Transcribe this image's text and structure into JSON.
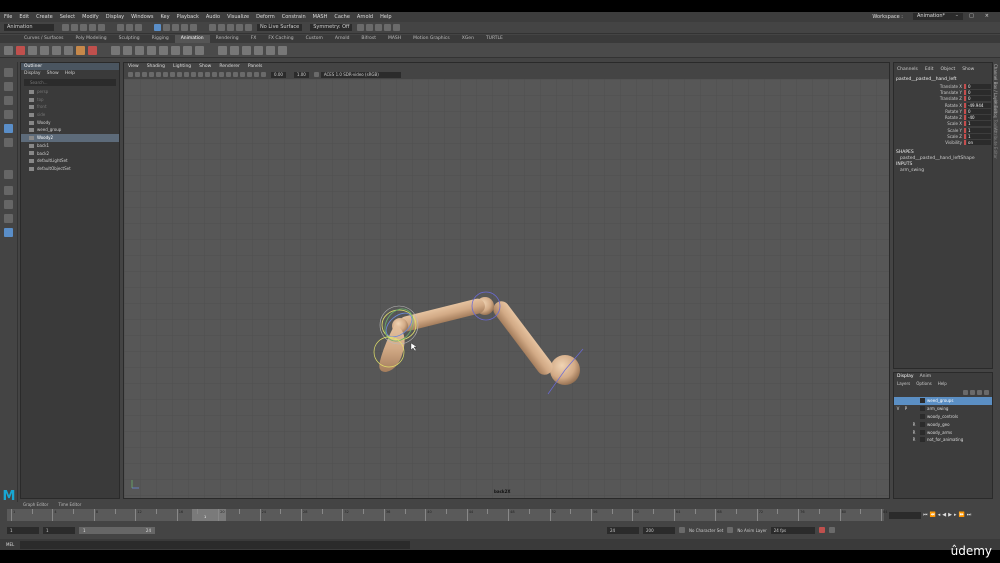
{
  "menus": [
    "File",
    "Edit",
    "Create",
    "Select",
    "Modify",
    "Display",
    "Windows",
    "Key",
    "Playback",
    "Audio",
    "Visualize",
    "Deform",
    "Constrain",
    "MASH",
    "Cache",
    "Arnold",
    "Help"
  ],
  "workspace": {
    "label": "Workspace :",
    "value": "Animation*"
  },
  "status": {
    "menuset": "Animation",
    "live_surface": "No Live Surface",
    "symmetry": "Symmetry: Off"
  },
  "shelf_tabs": [
    "Curves / Surfaces",
    "Poly Modeling",
    "Sculpting",
    "Rigging",
    "Animation",
    "Rendering",
    "FX",
    "FX Caching",
    "Custom",
    "Arnold",
    "Bifrost",
    "MASH",
    "Motion Graphics",
    "XGen",
    "TURTLE"
  ],
  "shelf_active": "Animation",
  "outliner": {
    "title": "Outliner",
    "menu": [
      "Display",
      "Show",
      "Help"
    ],
    "search_placeholder": "Search...",
    "items": [
      {
        "label": "persp",
        "state": "dim"
      },
      {
        "label": "top",
        "state": "dim"
      },
      {
        "label": "front",
        "state": "dim"
      },
      {
        "label": "side",
        "state": "dim"
      },
      {
        "label": "Woody",
        "state": "normal"
      },
      {
        "label": "weed_group",
        "state": "normal"
      },
      {
        "label": "Woody2",
        "state": "selected"
      },
      {
        "label": "back1",
        "state": "normal"
      },
      {
        "label": "back2",
        "state": "normal"
      },
      {
        "label": "defaultLightSet",
        "state": "normal"
      },
      {
        "label": "defaultObjectSet",
        "state": "normal"
      }
    ]
  },
  "viewport": {
    "menu": [
      "View",
      "Shading",
      "Lighting",
      "Show",
      "Renderer",
      "Panels"
    ],
    "near": "0.00",
    "far": "1.00",
    "colorspace": "ACES 1.0 SDR-video (sRGB)",
    "camera": "back2X"
  },
  "channel_box": {
    "tabs": [
      "Channels",
      "Edit",
      "Object",
      "Show"
    ],
    "object": "pasted__pasted__hand_left",
    "attributes": [
      {
        "name": "Translate X",
        "value": "0"
      },
      {
        "name": "Translate Y",
        "value": "0"
      },
      {
        "name": "Translate Z",
        "value": "0"
      },
      {
        "name": "Rotate X",
        "value": "-49.944"
      },
      {
        "name": "Rotate Y",
        "value": "0"
      },
      {
        "name": "Rotate Z",
        "value": "-40"
      },
      {
        "name": "Scale X",
        "value": "1"
      },
      {
        "name": "Scale Y",
        "value": "1"
      },
      {
        "name": "Scale Z",
        "value": "1"
      },
      {
        "name": "Visibility",
        "value": "on"
      }
    ],
    "shapes_label": "SHAPES",
    "shape_name": "pasted__pasted__hand_leftShape",
    "inputs_label": "INPUTS",
    "input_name": "arm_swing"
  },
  "side_tabs": [
    "Channel Box / Layer Editor",
    "Modeling Toolkit",
    "Attribute Editor"
  ],
  "layers": {
    "tabs": [
      "Display",
      "Anim"
    ],
    "menu": [
      "Layers",
      "Options",
      "Help"
    ],
    "rows": [
      {
        "v": "",
        "p": "",
        "r": "",
        "name": "weed_groups",
        "selected": true
      },
      {
        "v": "V",
        "p": "P",
        "r": "",
        "name": "arm_swing",
        "selected": false
      },
      {
        "v": "",
        "p": "",
        "r": "",
        "name": "woody_controls",
        "selected": false
      },
      {
        "v": "",
        "p": "",
        "r": "R",
        "name": "woody_geo",
        "selected": false
      },
      {
        "v": "",
        "p": "",
        "r": "R",
        "name": "woody_arms",
        "selected": false
      },
      {
        "v": "",
        "p": "",
        "r": "R",
        "name": "not_for_animating",
        "selected": false
      }
    ]
  },
  "timeline": {
    "tabs": [
      "Graph Editor",
      "Time Editor"
    ],
    "current_frame": "1",
    "ticks": [
      "1",
      "",
      "4",
      "",
      "8",
      "",
      "12",
      "",
      "16",
      "",
      "20",
      "",
      "24",
      "",
      "28",
      "",
      "32",
      "",
      "36",
      "",
      "40",
      "",
      "44",
      "",
      "48",
      "",
      "52",
      "",
      "56",
      "",
      "60",
      "",
      "64",
      "",
      "68",
      "",
      "72",
      "",
      "76",
      "",
      "80",
      "",
      "84"
    ]
  },
  "range": {
    "start": "1",
    "playback_start": "1",
    "slider_start": "1",
    "slider_end": "24",
    "playback_end": "24",
    "end": "200",
    "character_set": "No Character Set",
    "anim_layer": "No Anim Layer",
    "fps": "24 fps"
  },
  "command_line": {
    "label": "MEL"
  },
  "watermark": "ûdemy",
  "colors": {
    "viewport_bg": "#555555",
    "grid": "#4e4e4e",
    "wood": "#d2aa86",
    "selection": "#5b8fc4",
    "brand": "#18a6d2"
  }
}
